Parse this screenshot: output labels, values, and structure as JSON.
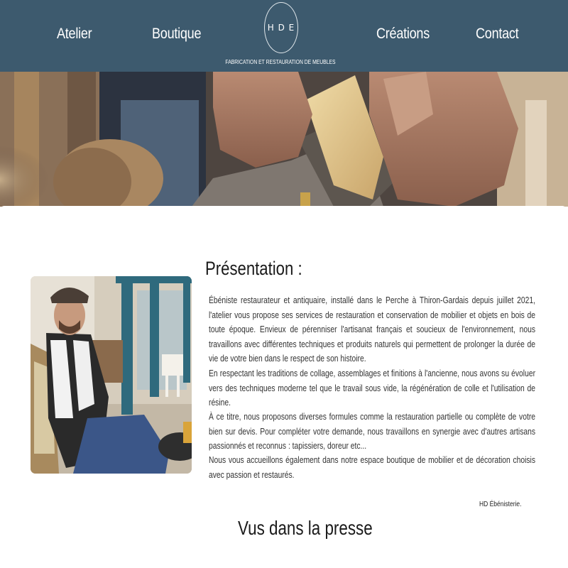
{
  "header": {
    "nav": [
      "Atelier",
      "Boutique",
      "Créations",
      "Contact"
    ],
    "logo_text": "H D E",
    "tagline": "FABRICATION ET RESTAURATION DE MEUBLES",
    "colors": {
      "background": "#3d5a6e",
      "text": "#ffffff"
    }
  },
  "hero": {
    "icon": "woodworking-hands-planing-image"
  },
  "presentation": {
    "title": "Présentation :",
    "portrait_icon": "craftsman-portrait-photo",
    "paragraphs": [
      "Ébéniste restaurateur et antiquaire, installé dans le Perche à Thiron-Gardais depuis juillet 2021, l'atelier vous propose ses services de restauration et conservation de mobilier et objets en bois de toute époque.  Envieux de pérenniser l'artisanat français et soucieux de l'environnement, nous travaillons avec différentes techniques et produits naturels qui permettent de prolonger la durée de vie de votre bien dans le respect de son histoire.",
      "En respectant les traditions de collage, assemblages et finitions à l'ancienne, nous avons su évoluer vers des techniques moderne tel que le travail sous vide, la régénération de colle et l'utilisation de résine.",
      "À ce titre, nous proposons diverses formules comme la restauration partielle ou complète de votre bien sur devis. Pour compléter votre demande, nous travaillons en synergie avec d'autres artisans passionnés et reconnus : tapissiers, doreur etc...",
      "Nous vous accueillons également dans notre espace boutique de mobilier et de décoration choisis avec passion et restaurés."
    ],
    "signature": "HD  Ébénisterie."
  },
  "press": {
    "title": "Vus dans la presse"
  }
}
